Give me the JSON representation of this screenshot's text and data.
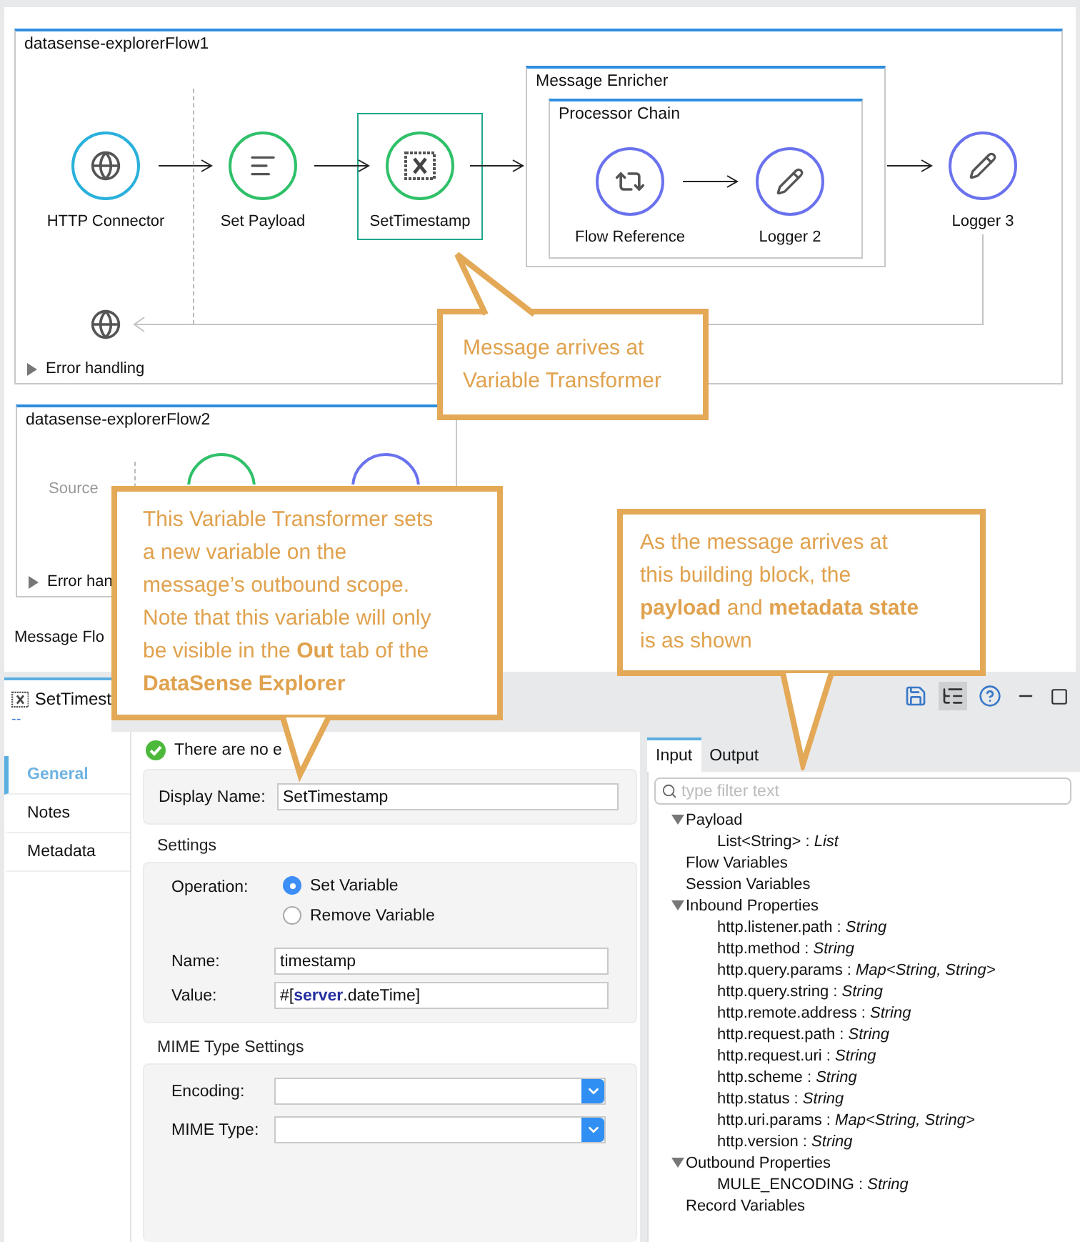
{
  "canvas": {
    "flows": [
      {
        "title": "datasense-explorerFlow1",
        "nodes": [
          {
            "kind": "connector",
            "label": "HTTP Connector",
            "selected": false
          },
          {
            "kind": "set-payload",
            "label": "Set Payload",
            "selected": false
          },
          {
            "kind": "variable",
            "label": "SetTimestamp",
            "selected": true
          }
        ],
        "enricher": {
          "title": "Message Enricher",
          "chain": {
            "title": "Processor Chain",
            "nodes": [
              {
                "kind": "flow-ref",
                "label": "Flow Reference",
                "selected": false
              },
              {
                "kind": "logger",
                "label": "Logger 2",
                "selected": false
              }
            ]
          }
        },
        "after": [
          {
            "kind": "logger",
            "label": "Logger 3",
            "selected": false
          }
        ],
        "error_handling": "Error handling"
      },
      {
        "title": "datasense-explorerFlow2",
        "source": "Source",
        "nodes": [
          {
            "kind": "set-payload",
            "selected": false
          },
          {
            "kind": "logger",
            "selected": false
          }
        ],
        "error_handling": "Error han"
      }
    ],
    "tab": "Message Flo"
  },
  "properties": {
    "tab": {
      "title": "SetTimest",
      "subtitle": "--"
    },
    "nav": [
      {
        "label": "General",
        "selected": true
      },
      {
        "label": "Notes",
        "selected": false
      },
      {
        "label": "Metadata",
        "selected": false
      }
    ],
    "status": "There are no e",
    "display_name": {
      "label": "Display Name:",
      "value": "SetTimestamp"
    },
    "settings": {
      "title": "Settings",
      "operation_label": "Operation:",
      "options": [
        {
          "label": "Set Variable",
          "selected": true
        },
        {
          "label": "Remove Variable",
          "selected": false
        }
      ],
      "fields": [
        {
          "label": "Name:",
          "value": "timestamp"
        },
        {
          "label": "Value:",
          "value": "#[**server**.dateTime]"
        }
      ]
    },
    "mime": {
      "title": "MIME Type Settings",
      "fields": [
        {
          "label": "Encoding:"
        },
        {
          "label": "MIME Type:"
        }
      ]
    }
  },
  "datasense": {
    "tabs": [
      {
        "label": "Input",
        "selected": true
      },
      {
        "label": "Output",
        "selected": false
      }
    ],
    "filter": {
      "placeholder": "type filter text"
    },
    "tree": [
      {
        "label": "Payload",
        "expanded": true,
        "children": [
          {
            "label": "List<String> : *List*"
          }
        ]
      },
      {
        "label": "Flow Variables"
      },
      {
        "label": "Session Variables"
      },
      {
        "label": "Inbound Properties",
        "expanded": true,
        "children": [
          {
            "label": "http.listener.path : *String*"
          },
          {
            "label": "http.method : *String*"
          },
          {
            "label": "http.query.params : *Map<String, String>*"
          },
          {
            "label": "http.query.string : *String*"
          },
          {
            "label": "http.remote.address : *String*"
          },
          {
            "label": "http.request.path : *String*"
          },
          {
            "label": "http.request.uri : *String*"
          },
          {
            "label": "http.scheme : *String*"
          },
          {
            "label": "http.status : *String*"
          },
          {
            "label": "http.uri.params : *Map<String, String>*"
          },
          {
            "label": "http.version : *String*"
          }
        ]
      },
      {
        "label": "Outbound Properties",
        "expanded": true,
        "children": [
          {
            "label": "MULE_ENCODING : *String*"
          }
        ]
      },
      {
        "label": "Record Variables"
      }
    ]
  },
  "callouts": [
    {
      "text": "Message arrives at\nVariable Transformer"
    },
    {
      "text": "This Variable Transformer sets\na new variable on the\nmessage’s outbound scope.\nNote that this variable will only\nbe visible in the **Out** tab of the\n**DataSense Explorer**"
    },
    {
      "text": "As the message arrives at\nthis building block, the\n**payload** and **metadata state**\nis as shown"
    }
  ]
}
